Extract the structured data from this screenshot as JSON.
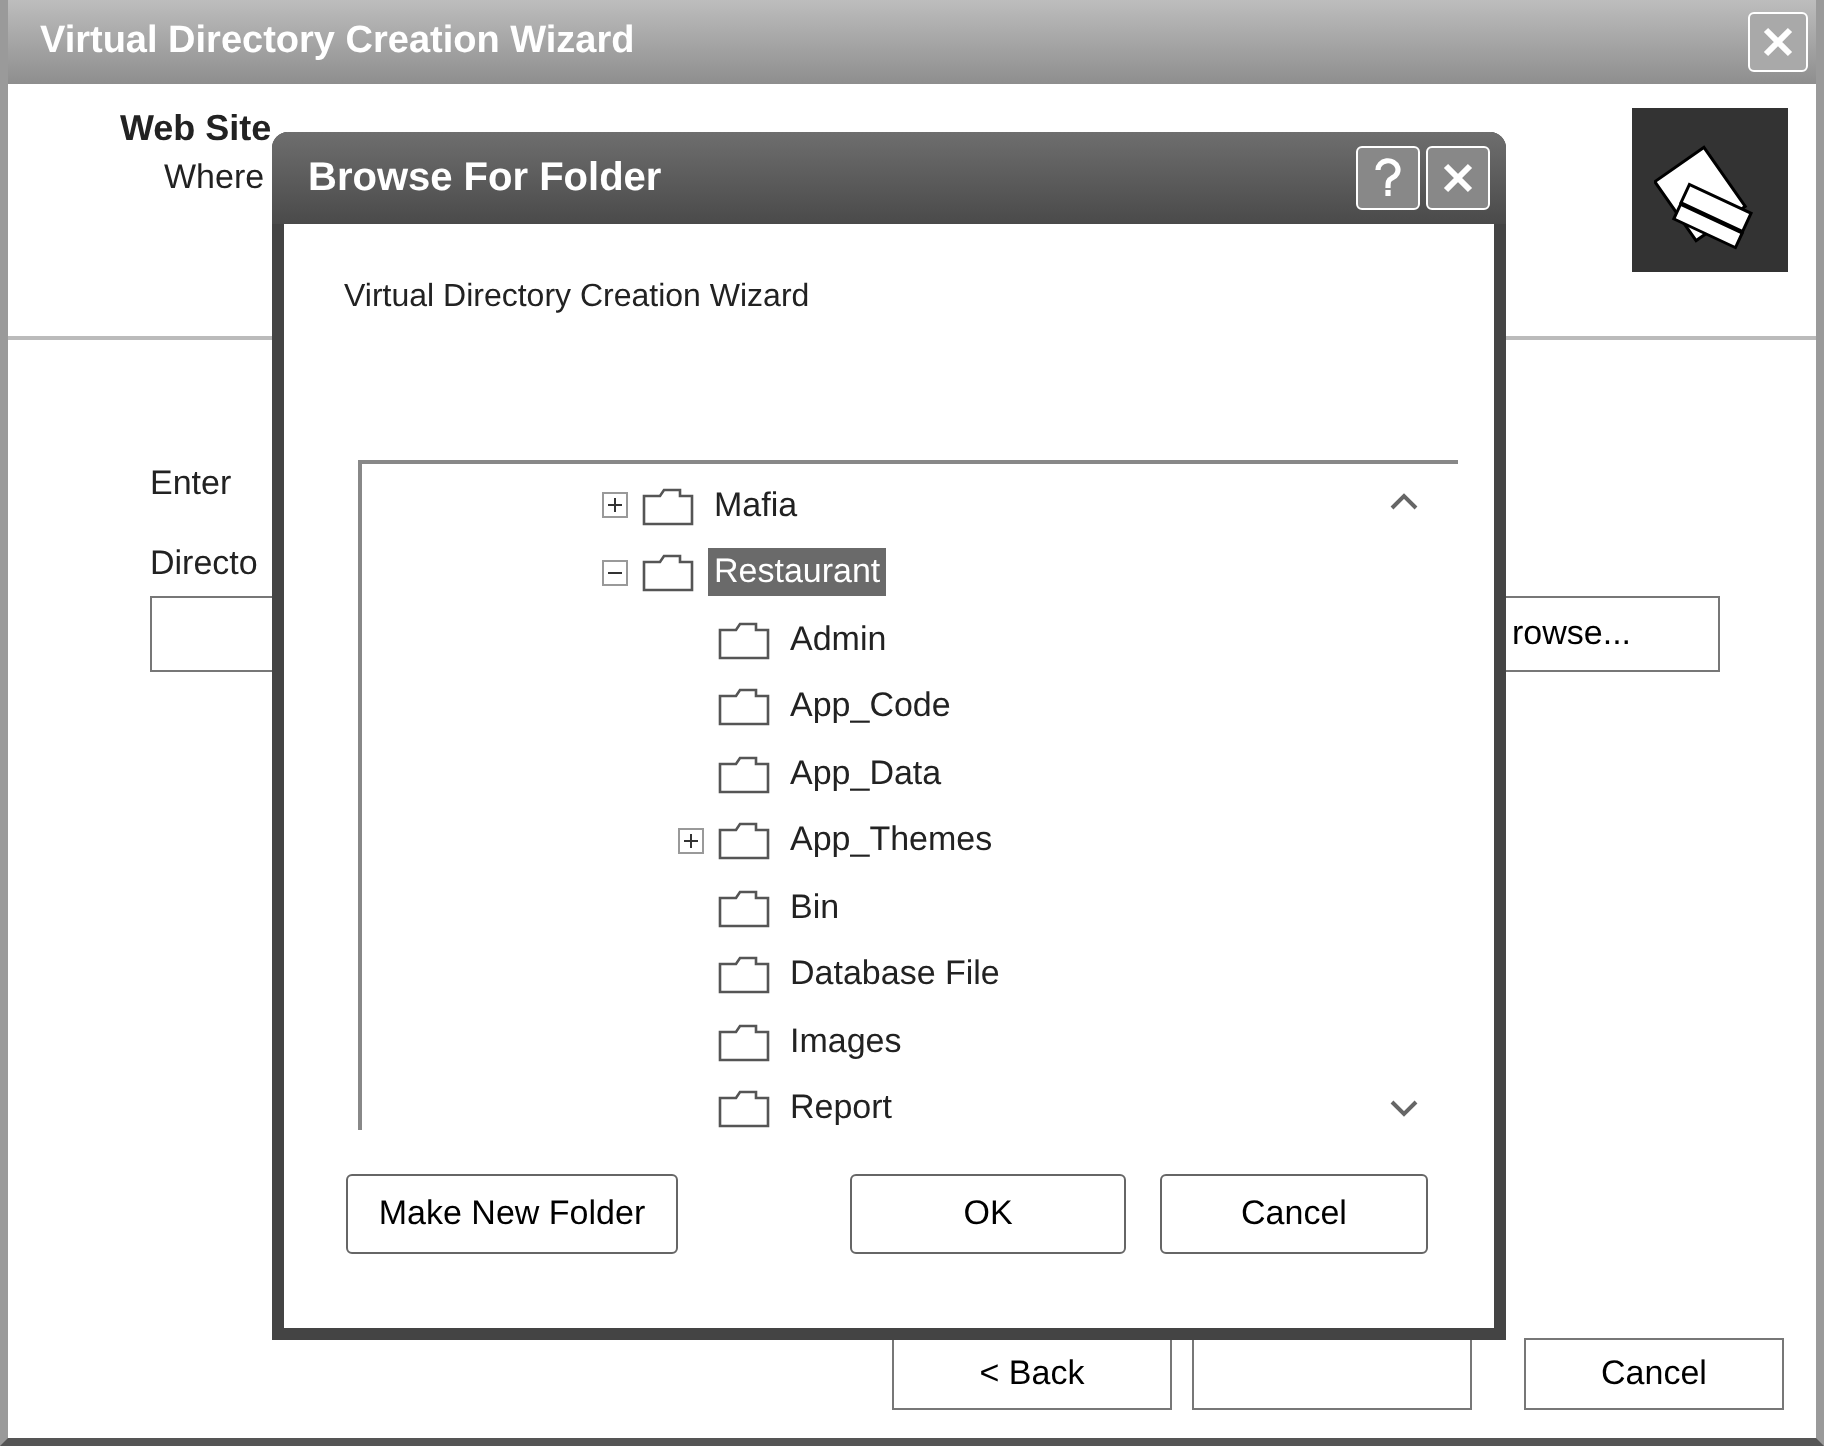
{
  "wizard": {
    "title": "Virtual Directory Creation Wizard",
    "header_title": "Web Site",
    "header_subtitle": "Where",
    "prompt": "Enter",
    "directory_label": "Directo",
    "browse_button": "rowse...",
    "back_button": "< Back",
    "cancel_button": "Cancel"
  },
  "dialog": {
    "title": "Browse For Folder",
    "description": "Virtual Directory Creation Wizard",
    "tree": [
      {
        "label": "Mafia",
        "expanded": false,
        "selected": false
      },
      {
        "label": "Restaurant",
        "expanded": true,
        "selected": true,
        "children": [
          {
            "label": "Admin",
            "selected": false
          },
          {
            "label": "App_Code",
            "selected": false
          },
          {
            "label": "App_Data",
            "selected": false
          },
          {
            "label": "App_Themes",
            "expanded": false,
            "selected": false
          },
          {
            "label": "Bin",
            "selected": false
          },
          {
            "label": "Database File",
            "selected": false
          },
          {
            "label": "Images",
            "selected": false
          },
          {
            "label": "Report",
            "selected": false
          }
        ]
      }
    ],
    "buttons": [
      {
        "label": "Make New Folder"
      },
      {
        "label": "OK"
      },
      {
        "label": "Cancel"
      }
    ]
  }
}
